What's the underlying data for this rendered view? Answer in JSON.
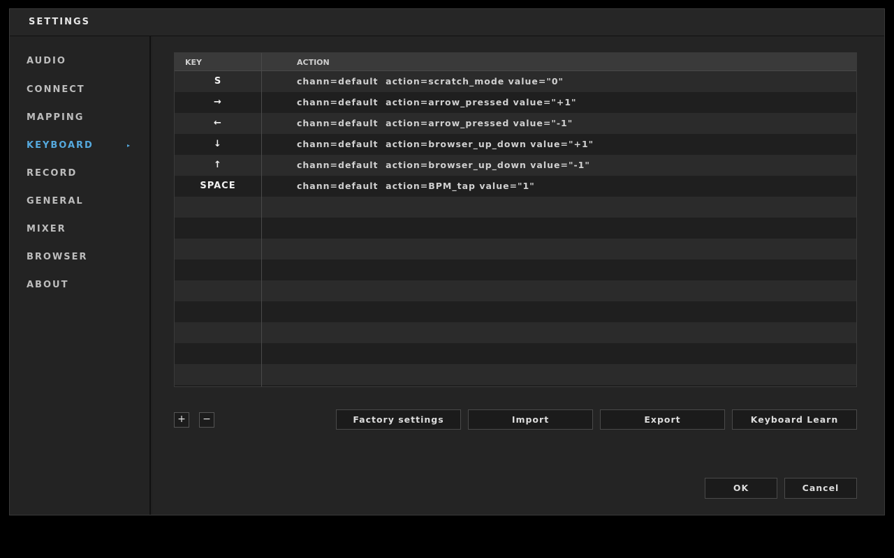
{
  "window": {
    "title": "SETTINGS"
  },
  "sidebar": {
    "items": [
      {
        "label": "AUDIO"
      },
      {
        "label": "CONNECT"
      },
      {
        "label": "MAPPING"
      },
      {
        "label": "KEYBOARD",
        "active": true
      },
      {
        "label": "RECORD"
      },
      {
        "label": "GENERAL"
      },
      {
        "label": "MIXER"
      },
      {
        "label": "BROWSER"
      },
      {
        "label": "ABOUT"
      }
    ],
    "active_chevron": "▸",
    "active_color": "#55a9de"
  },
  "table": {
    "headers": {
      "key": "KEY",
      "action": "ACTION"
    },
    "rows": [
      {
        "key": "S",
        "action": "chann=default  action=scratch_mode value=\"0\""
      },
      {
        "key": "→",
        "action": "chann=default  action=arrow_pressed value=\"+1\""
      },
      {
        "key": "←",
        "action": "chann=default  action=arrow_pressed value=\"-1\""
      },
      {
        "key": "↓",
        "action": "chann=default  action=browser_up_down value=\"+1\""
      },
      {
        "key": "↑",
        "action": "chann=default  action=browser_up_down value=\"-1\""
      },
      {
        "key": "SPACE",
        "action": "chann=default  action=BPM_tap value=\"1\""
      }
    ]
  },
  "controls": {
    "add_label": "+",
    "remove_label": "−",
    "factory_label": "Factory settings",
    "import_label": "Import",
    "export_label": "Export",
    "learn_label": "Keyboard Learn",
    "ok_label": "OK",
    "cancel_label": "Cancel"
  }
}
